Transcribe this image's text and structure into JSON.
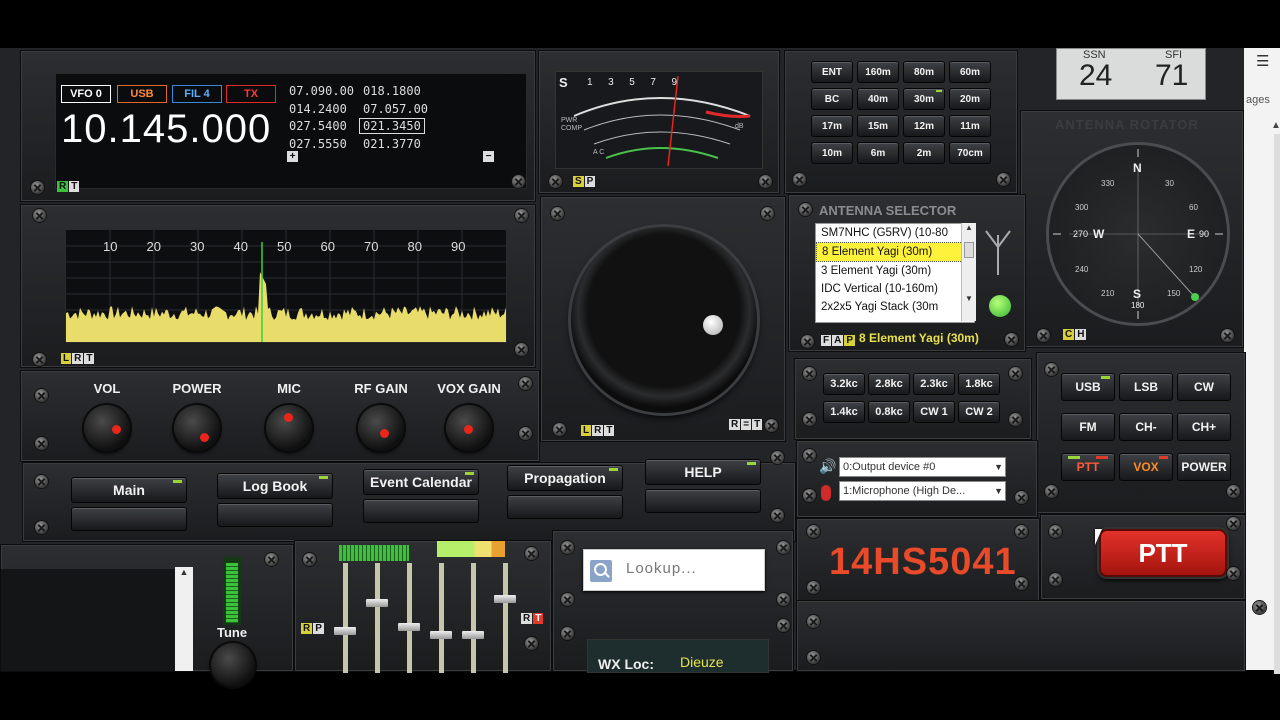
{
  "radio": {
    "vfo_label": "VFO 0",
    "mode_label": "USB",
    "filter_label": "FIL 4",
    "tx_label": "TX",
    "frequency": "10.145.000",
    "memories": [
      [
        "07.090.00",
        "018.1800"
      ],
      [
        "014.2400",
        "07.057.00"
      ],
      [
        "027.5400",
        "021.3450"
      ],
      [
        "027.5550",
        "021.3770"
      ]
    ],
    "plus": "+",
    "minus": "−",
    "tag_rt": [
      "R",
      "T"
    ]
  },
  "meter": {
    "s_label": "S",
    "s_scale": [
      "1",
      "3",
      "5",
      "7",
      "9"
    ],
    "pwr_label": "PWR",
    "comp_label": "COMP",
    "alc_label": "A C",
    "db_label": "dB",
    "tag_sp": [
      "S",
      "P"
    ]
  },
  "bands": [
    "ENT",
    "160m",
    "80m",
    "60m",
    "BC",
    "40m",
    "30m",
    "20m",
    "17m",
    "15m",
    "12m",
    "11m",
    "10m",
    "6m",
    "2m",
    "70cm"
  ],
  "solar": {
    "ssn_label": "SSN",
    "ssn_value": "24",
    "sfi_label": "SFI",
    "sfi_value": "71"
  },
  "spectrum": {
    "scale": [
      "10",
      "20",
      "30",
      "40",
      "50",
      "60",
      "70",
      "80",
      "90"
    ],
    "tag": [
      "L",
      "R",
      "T"
    ]
  },
  "dial": {
    "tag": [
      "L",
      "R",
      "T"
    ],
    "tag_right": [
      "R",
      "=",
      "T"
    ]
  },
  "antenna": {
    "title": "ANTENNA SELECTOR",
    "items": [
      "SM7NHC (G5RV) (10-80",
      "8 Element Yagi (30m)",
      "3 Element Yagi (30m)",
      "IDC Vertical (10-160m)",
      "2x2x5 Yagi Stack (30m"
    ],
    "selected": "8 Element Yagi (30m)",
    "tag": [
      "F",
      "A",
      "P"
    ]
  },
  "rotator": {
    "title": "ANTENNA ROTATOR",
    "labels": {
      "n": "N",
      "e": "E",
      "s": "S",
      "w": "W",
      "e_deg": "90",
      "w_deg": "270",
      "s_deg": "180"
    },
    "ticks": [
      "30",
      "60",
      "120",
      "150",
      "210",
      "240",
      "300",
      "330"
    ],
    "tag": [
      "C",
      "H"
    ],
    "side_glyph": "☰",
    "side_text": "ages"
  },
  "knobs": [
    "VOL",
    "POWER",
    "MIC",
    "RF GAIN",
    "VOX GAIN"
  ],
  "filters": [
    "3.2kc",
    "2.8kc",
    "2.3kc",
    "1.8kc",
    "1.4kc",
    "0.8kc",
    "CW 1",
    "CW 2"
  ],
  "modes": [
    "USB",
    "LSB",
    "CW",
    "FM",
    "CH-",
    "CH+",
    "PTT",
    "VOX",
    "POWER"
  ],
  "nav": [
    "Main",
    "Log Book",
    "Event Calendar",
    "Propagation",
    "HELP"
  ],
  "audio": {
    "output": "0:Output device #0",
    "input": "1:Microphone (High De..."
  },
  "lookup": {
    "placeholder": "Lookup..."
  },
  "callsign": "14HS5041",
  "ptt_big": "PTT",
  "tune": {
    "label": "Tune"
  },
  "mixer": {
    "tag_left": [
      "R",
      "P"
    ],
    "tag_right": [
      "R",
      "T"
    ]
  },
  "wx": {
    "label": "WX Loc:",
    "value": "Dieuze"
  }
}
